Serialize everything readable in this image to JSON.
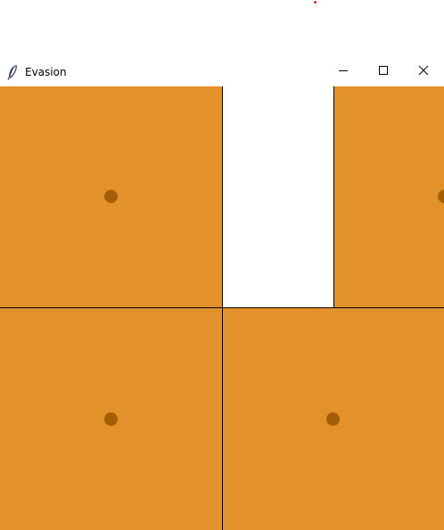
{
  "window": {
    "title": "Evasion",
    "icon": "feather-icon",
    "controls": {
      "minimize": "minimize-icon",
      "maximize": "maximize-icon",
      "close": "close-icon"
    }
  },
  "colors": {
    "tile": "#e3912a",
    "empty": "#ffffff",
    "piece": "#a45f06",
    "grid": "#000000",
    "marker": "#d32f2f"
  },
  "board": {
    "tiles": [
      {
        "name": "tile-top-left",
        "state": "filled",
        "has_piece": true
      },
      {
        "name": "tile-top-middle",
        "state": "empty",
        "has_piece": false
      },
      {
        "name": "tile-top-right",
        "state": "filled",
        "has_piece": true
      },
      {
        "name": "tile-bottom-left",
        "state": "filled",
        "has_piece": true
      },
      {
        "name": "tile-bottom-right",
        "state": "filled",
        "has_piece": true
      }
    ]
  }
}
